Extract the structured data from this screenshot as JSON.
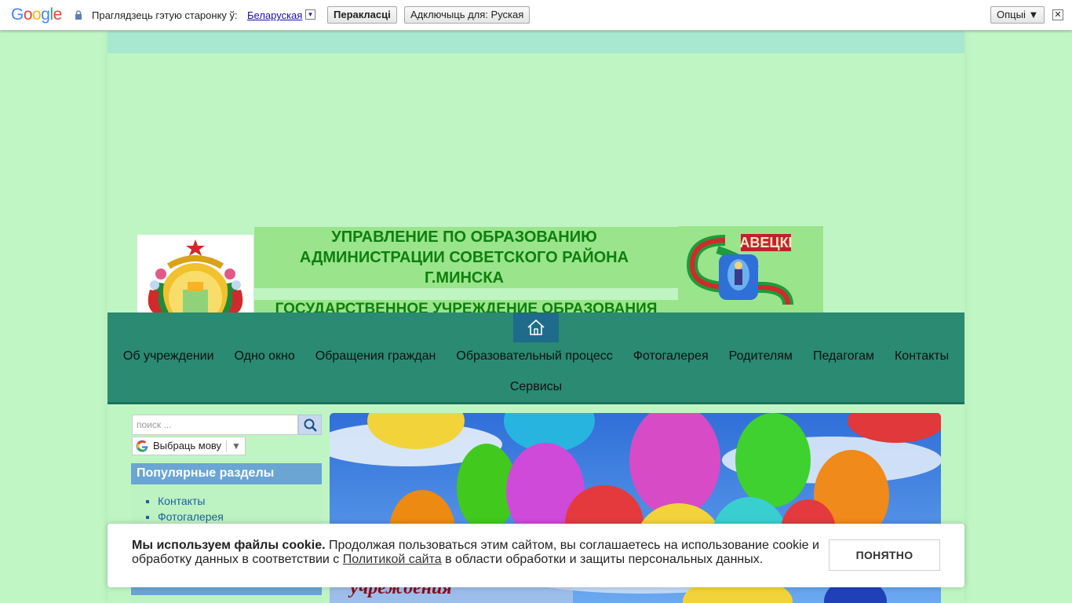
{
  "translate_bar": {
    "logo": "Google",
    "prompt": "Праглядзець гэтую старонку ў:",
    "language_link": "Беларуская",
    "dropdown_glyph": "▾",
    "translate_button": "Перакласці",
    "disable_button": "Адключыць для: Руская",
    "options_button": "Опцыі ▼",
    "close_glyph": "✕"
  },
  "header": {
    "title_line1": "УПРАВЛЕНИЕ ПО ОБРАЗОВАНИЮ",
    "title_line2": "АДМИНИСТРАЦИИ СОВЕТСКОГО РАЙОНА",
    "title_line3": "Г.МИНСКА",
    "subtitle": "ГОСУДАРСТВЕННОЕ УЧРЕЖДЕНИЕ ОБРАЗОВАНИЯ",
    "logo_text": "АВЕЦКІ",
    "title_color": "#0d7f0d"
  },
  "nav": {
    "row1": [
      "Об учреждении",
      "Одно окно",
      "Обращения граждан",
      "Образовательный процесс",
      "Фотогалерея",
      "Родителям",
      "Педагогам",
      "Контакты"
    ],
    "row2": [
      "Сервисы"
    ],
    "bg_color": "#2a8a72",
    "home_color": "#1e6b8a"
  },
  "sidebar": {
    "search_placeholder": "поиск ...",
    "language_select": "Выбраць мову",
    "language_arrow": "▼",
    "popular_heading": "Популярные разделы",
    "popular_items": [
      "Контакты",
      "Фотогалерея"
    ]
  },
  "hero": {
    "caption": "учреждения"
  },
  "cookie": {
    "bold": "Мы используем файлы cookie.",
    "text1": "Продолжая пользоваться этим сайтом, вы соглашаетесь на использование cookie и обработку данных в соответствии с",
    "link": "Политикой сайта",
    "text2": "в области обработки и защиты персональных данных.",
    "button": "ПОНЯТНО"
  }
}
